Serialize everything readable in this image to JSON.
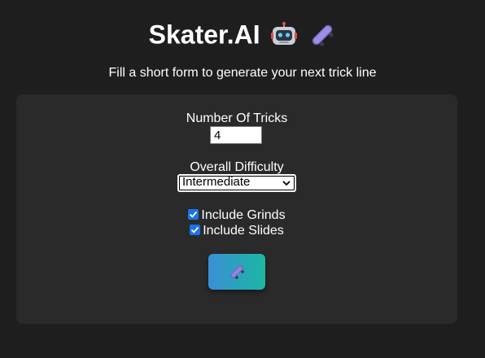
{
  "header": {
    "title": "Skater.AI",
    "icons": [
      "robot-icon",
      "skateboard-icon"
    ]
  },
  "subtitle": "Fill a short form to generate your next trick line",
  "form": {
    "tricks_label": "Number Of Tricks",
    "tricks_value": "4",
    "difficulty_label": "Overall Difficulty",
    "difficulty_value": "Intermediate",
    "grinds_label": "Include Grinds",
    "grinds_checked": true,
    "slides_label": "Include Slides",
    "slides_checked": true,
    "submit_icon": "skateboard-icon"
  },
  "colors": {
    "background": "#1e1e1e",
    "card": "#2a2a2a",
    "checkbox": "#1a73e8",
    "button_gradient_start": "#3a8fd6",
    "button_gradient_end": "#1ab8a2"
  }
}
